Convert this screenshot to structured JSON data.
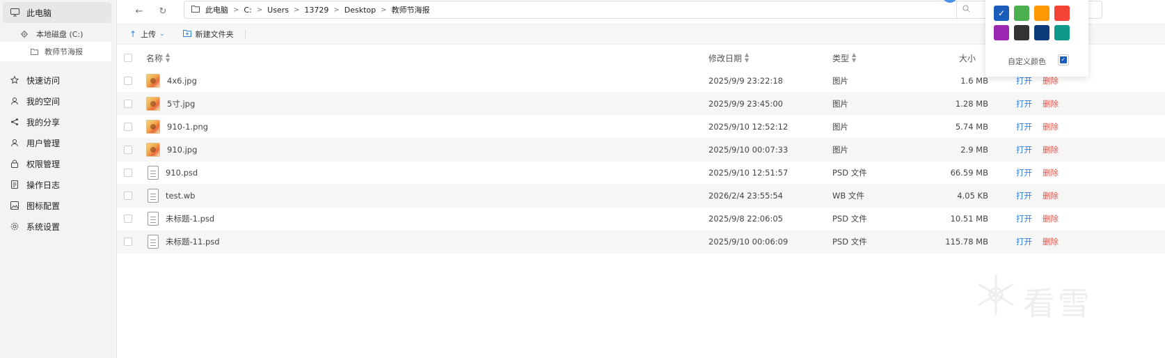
{
  "sidebar": {
    "this_pc": "此电脑",
    "local_disk": "本地磁盘 (C:)",
    "current_folder": "教师节海报",
    "items": [
      {
        "label": "快速访问",
        "icon": "star-icon"
      },
      {
        "label": "我的空间",
        "icon": "user-icon"
      },
      {
        "label": "我的分享",
        "icon": "share-icon"
      },
      {
        "label": "用户管理",
        "icon": "user-icon"
      },
      {
        "label": "权限管理",
        "icon": "lock-icon"
      },
      {
        "label": "操作日志",
        "icon": "document-icon"
      },
      {
        "label": "图标配置",
        "icon": "image-icon"
      },
      {
        "label": "系统设置",
        "icon": "gear-icon"
      }
    ]
  },
  "breadcrumb": [
    "此电脑",
    "C:",
    "Users",
    "13729",
    "Desktop",
    "教师节海报"
  ],
  "toolbar": {
    "upload": "上传",
    "new_folder": "新建文件夹"
  },
  "table": {
    "headers": {
      "name": "名称",
      "modified": "修改日期",
      "type": "类型",
      "size": "大小"
    },
    "rows": [
      {
        "name": "4x6.jpg",
        "modified": "2025/9/9 23:22:18",
        "type": "图片",
        "size": "1.6 MB",
        "kind": "image"
      },
      {
        "name": "5寸.jpg",
        "modified": "2025/9/9 23:45:00",
        "type": "图片",
        "size": "1.28 MB",
        "kind": "image"
      },
      {
        "name": "910-1.png",
        "modified": "2025/9/10 12:52:12",
        "type": "图片",
        "size": "5.74 MB",
        "kind": "image"
      },
      {
        "name": "910.jpg",
        "modified": "2025/9/10 00:07:33",
        "type": "图片",
        "size": "2.9 MB",
        "kind": "image"
      },
      {
        "name": "910.psd",
        "modified": "2025/9/10 12:51:57",
        "type": "PSD 文件",
        "size": "66.59 MB",
        "kind": "file"
      },
      {
        "name": "test.wb",
        "modified": "2026/2/4 23:55:54",
        "type": "WB 文件",
        "size": "4.05 KB",
        "kind": "file"
      },
      {
        "name": "未标题-1.psd",
        "modified": "2025/9/8 22:06:05",
        "type": "PSD 文件",
        "size": "10.51 MB",
        "kind": "file"
      },
      {
        "name": "未标题-11.psd",
        "modified": "2025/9/10 00:06:09",
        "type": "PSD 文件",
        "size": "115.78 MB",
        "kind": "file"
      }
    ],
    "open_label": "打开",
    "delete_label": "删除"
  },
  "color_picker": {
    "swatches": [
      "#1a5cbb",
      "#4caf50",
      "#ff9800",
      "#f44336",
      "#9c27b0",
      "#333333",
      "#0d3a7a",
      "#0e9a8a"
    ],
    "selected": "#1a5cbb",
    "custom_label": "自定义颜色"
  },
  "watermark": "看雪",
  "colors": {
    "accent": "#2d7fe0",
    "danger": "#e2554a"
  }
}
